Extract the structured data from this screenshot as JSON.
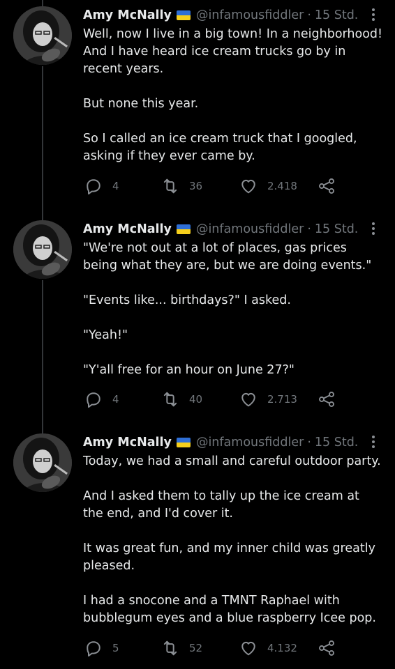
{
  "tweets": [
    {
      "author": {
        "name": "Amy McNally",
        "handle": "@infamousfiddler",
        "time": "15 Std.",
        "flag": "ukraine"
      },
      "paragraphs": [
        "Well, now I live in a big town!  In a neighborhood! And I have heard ice cream trucks go by in recent years.",
        "But none this year.",
        "So I called an ice cream truck that I googled, asking if they ever came by."
      ],
      "stats": {
        "replies": "4",
        "retweets": "36",
        "likes": "2.418"
      }
    },
    {
      "author": {
        "name": "Amy McNally",
        "handle": "@infamousfiddler",
        "time": "15 Std.",
        "flag": "ukraine"
      },
      "paragraphs": [
        "\"We're not out at a lot of places, gas prices being what they are, but we are doing events.\"",
        "\"Events like... birthdays?\" I asked.",
        "\"Yeah!\"",
        "\"Y'all free for an hour on June 27?\""
      ],
      "stats": {
        "replies": "4",
        "retweets": "40",
        "likes": "2.713"
      }
    },
    {
      "author": {
        "name": "Amy McNally",
        "handle": "@infamousfiddler",
        "time": "15 Std.",
        "flag": "ukraine"
      },
      "paragraphs": [
        "Today, we had a small and careful outdoor party.",
        "And I asked them to tally up the ice cream at the end, and I'd cover it.",
        "It was great fun, and my inner child was greatly pleased.",
        "I had a snocone and a TMNT Raphael with bubblegum eyes and a blue raspberry Icee pop."
      ],
      "stats": {
        "replies": "5",
        "retweets": "52",
        "likes": "4.132"
      }
    }
  ],
  "separator": "·",
  "icons": {
    "reply": "reply-icon",
    "retweet": "retweet-icon",
    "like": "heart-icon",
    "share": "share-icon",
    "more": "more-options-icon"
  },
  "colors": {
    "background": "#000000",
    "text": "#e7e9ea",
    "muted": "#71767b",
    "thread_line": "#333639"
  }
}
